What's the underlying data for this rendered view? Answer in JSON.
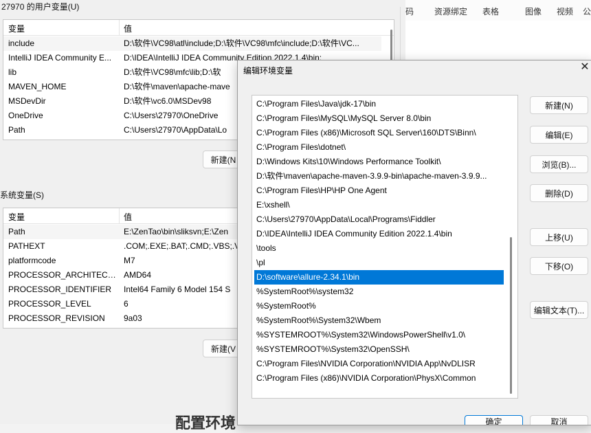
{
  "toolbar": {
    "items": [
      "码",
      "资源绑定",
      "表格",
      "图像",
      "视频",
      "公"
    ]
  },
  "user_vars": {
    "title": "27970 的用户变量(U)",
    "headers": [
      "变量",
      "值"
    ],
    "rows": [
      [
        "include",
        "D:\\软件\\VC98\\atl\\include;D:\\软件\\VC98\\mfc\\include;D:\\软件\\VC..."
      ],
      [
        "IntelliJ IDEA Community E...",
        "D:\\IDEA\\IntelliJ IDEA Community Edition 2022.1.4\\bin;"
      ],
      [
        "lib",
        "D:\\软件\\VC98\\mfc\\lib;D:\\软"
      ],
      [
        "MAVEN_HOME",
        "D:\\软件\\maven\\apache-mave"
      ],
      [
        "MSDevDir",
        "D:\\软件\\vc6.0\\MSDev98"
      ],
      [
        "OneDrive",
        "C:\\Users\\27970\\OneDrive"
      ],
      [
        "Path",
        "C:\\Users\\27970\\AppData\\Lo"
      ]
    ],
    "new_label": "新建(N"
  },
  "sys_vars": {
    "title": "系统变量(S)",
    "headers": [
      "变量",
      "值"
    ],
    "rows": [
      [
        "Path",
        "E:\\ZenTao\\bin\\sliksvn;E:\\Zen"
      ],
      [
        "PATHEXT",
        ".COM;.EXE;.BAT;.CMD;.VBS;.V"
      ],
      [
        "platformcode",
        "M7"
      ],
      [
        "PROCESSOR_ARCHITECT...",
        "AMD64"
      ],
      [
        "PROCESSOR_IDENTIFIER",
        "Intel64 Family 6 Model 154 S"
      ],
      [
        "PROCESSOR_LEVEL",
        "6"
      ],
      [
        "PROCESSOR_REVISION",
        "9a03"
      ]
    ],
    "new_label": "新建(V"
  },
  "dialog": {
    "title": "编辑环境变量",
    "close": "✕",
    "paths": [
      "C:\\Program Files\\Java\\jdk-17\\bin",
      "C:\\Program Files\\MySQL\\MySQL Server 8.0\\bin",
      "C:\\Program Files (x86)\\Microsoft SQL Server\\160\\DTS\\Binn\\",
      "C:\\Program Files\\dotnet\\",
      "D:\\Windows Kits\\10\\Windows Performance Toolkit\\",
      "D:\\软件\\maven\\apache-maven-3.9.9-bin\\apache-maven-3.9.9...",
      "C:\\Program Files\\HP\\HP One Agent",
      "E:\\xshell\\",
      "C:\\Users\\27970\\AppData\\Local\\Programs\\Fiddler",
      "D:\\IDEA\\IntelliJ IDEA Community Edition 2022.1.4\\bin",
      "\\tools",
      "\\pl",
      "D:\\software\\allure-2.34.1\\bin",
      "%SystemRoot%\\system32",
      "%SystemRoot%",
      "%SystemRoot%\\System32\\Wbem",
      "%SYSTEMROOT%\\System32\\WindowsPowerShell\\v1.0\\",
      "%SYSTEMROOT%\\System32\\OpenSSH\\",
      "C:\\Program Files\\NVIDIA Corporation\\NVIDIA App\\NvDLISR",
      "C:\\Program Files (x86)\\NVIDIA Corporation\\PhysX\\Common"
    ],
    "selected_index": 12,
    "buttons": {
      "new": "新建(N)",
      "edit": "编辑(E)",
      "browse": "浏览(B)...",
      "delete": "删除(D)",
      "move_up": "上移(U)",
      "move_down": "下移(O)",
      "edit_text": "编辑文本(T)...",
      "ok": "确定",
      "cancel": "取消"
    }
  },
  "background_text": "配置环境"
}
